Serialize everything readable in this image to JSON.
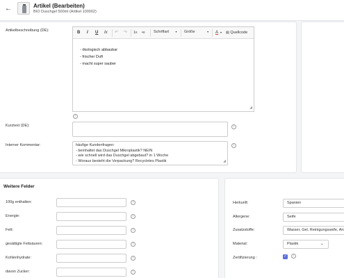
{
  "header": {
    "title": "Artikel (Bearbeiten)",
    "subtitle": "BIO Duschgel 500ml (Artikel 100002)"
  },
  "description": {
    "label": "Artikelbeschreibung (DE):",
    "toolbar": {
      "bold": "B",
      "italic": "I",
      "underline": "U",
      "clear_format": "Ix",
      "undo": "↶",
      "redo": "↷",
      "ordered_list": "1≡",
      "bullet_list": "•≡",
      "font": "Schriftart",
      "size": "Größe",
      "text_color": "A",
      "source": "Quellcode"
    },
    "lines": [
      "- ökologisch abbaubar",
      "- frischer Duft",
      "- macht super sauber"
    ]
  },
  "short_text": {
    "label": "Kurztext (DE):",
    "value": ""
  },
  "internal_comment": {
    "label": "Interner Kommentar:",
    "lines": [
      "häufige Kundenfragen:",
      "- beinhaltet das Duschgel Mikroplastik? NEIN",
      "- wie schnell wird das Duschgel abgebaut? in 1 Woche",
      "- Woraus besteht die Verpackung? Recycletes Plastik"
    ]
  },
  "further_fields": {
    "title": "Weitere Felder",
    "left_fields": [
      {
        "label": "100g enthalten:",
        "value": ""
      },
      {
        "label": "Energie:",
        "value": ""
      },
      {
        "label": "Fett:",
        "value": ""
      },
      {
        "label": "gesättigte Fettsäuren:",
        "value": ""
      },
      {
        "label": "Kohlenhydrate:",
        "value": ""
      },
      {
        "label": "davon Zucker:",
        "value": ""
      }
    ],
    "right_fields": {
      "origin": {
        "label": "Herkunft:",
        "value": "Spanien"
      },
      "allergens": {
        "label": "Allergene:",
        "value": "Seife"
      },
      "additives": {
        "label": "Zusatzstoffe:",
        "value": "Wasser, Gel, Reinigungsseife, Aroma"
      },
      "material": {
        "label": "Material:",
        "value": "Plastik"
      },
      "certification": {
        "label": "Zertifizierung :",
        "checked": true
      }
    }
  },
  "icons": {
    "back": "arrow-left",
    "info": "info-circle",
    "chevron": "chevron-down",
    "check": "checkmark"
  },
  "colors": {
    "accent": "#5b6fd8",
    "background": "#f4f5f7"
  }
}
